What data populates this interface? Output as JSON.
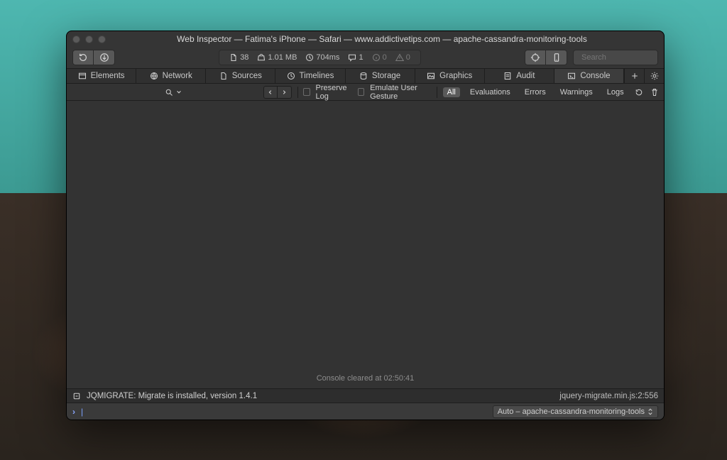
{
  "window": {
    "title": "Web Inspector — Fatima's iPhone — Safari — www.addictivetips.com — apache-cassandra-monitoring-tools"
  },
  "toolbar": {
    "search_placeholder": "Search"
  },
  "metrics": {
    "resources": "38",
    "size": "1.01 MB",
    "time": "704ms",
    "messages": "1",
    "info": "0",
    "warnings": "0"
  },
  "tabs": {
    "elements": "Elements",
    "network": "Network",
    "sources": "Sources",
    "timelines": "Timelines",
    "storage": "Storage",
    "graphics": "Graphics",
    "audit": "Audit",
    "console": "Console"
  },
  "filter": {
    "preserve_log": "Preserve Log",
    "emulate_user_gesture": "Emulate User Gesture",
    "all": "All",
    "evaluations": "Evaluations",
    "errors": "Errors",
    "warnings": "Warnings",
    "logs": "Logs"
  },
  "console": {
    "cleared": "Console cleared at 02:50:41",
    "log_message": "JQMIGRATE: Migrate is installed, version 1.4.1",
    "log_source": "jquery-migrate.min.js:2:556",
    "context": "Auto – apache-cassandra-monitoring-tools"
  }
}
